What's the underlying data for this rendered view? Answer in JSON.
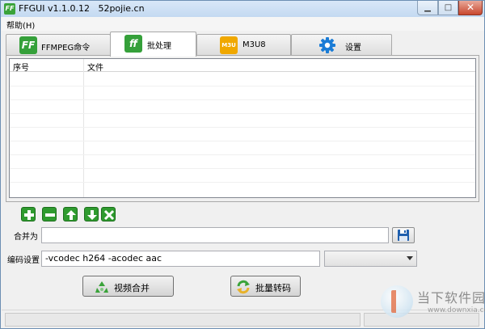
{
  "window": {
    "title": "FFGUI v1.1.0.12   52pojie.cn",
    "app_icon_text": "FF"
  },
  "menu": {
    "help": "帮助(H)"
  },
  "tabs": [
    {
      "label": "FFMPEG命令",
      "icon": "ff-logo-icon",
      "icon_text": "FF"
    },
    {
      "label": "批处理",
      "icon": "ff-logo-icon",
      "icon_text": "ff"
    },
    {
      "label": "M3U8",
      "icon": "m3u-icon",
      "icon_text": "M3U"
    },
    {
      "label": "设置",
      "icon": "gear-icon"
    }
  ],
  "active_tab": "批处理",
  "file_list": {
    "columns": [
      "序号",
      "文件"
    ],
    "rows": []
  },
  "toolbar": {
    "add": "add-icon",
    "remove": "remove-icon",
    "move_up": "move-up-icon",
    "move_down": "move-down-icon",
    "clear": "clear-icon"
  },
  "form": {
    "merge_label": "合并为",
    "merge_value": "",
    "encode_label": "编码设置",
    "encode_value": "-vcodec h264 -acodec aac",
    "preset_selected": ""
  },
  "buttons": {
    "merge_video": "视频合并",
    "batch_convert": "批量转码"
  },
  "watermark": {
    "text": "当下软件园",
    "sub": "www.downxia.com"
  },
  "colors": {
    "accent_green": "#2f9b2f",
    "m3u_orange": "#f0a800",
    "gear_blue": "#1a7cd6",
    "close_red": "#c8472e"
  }
}
